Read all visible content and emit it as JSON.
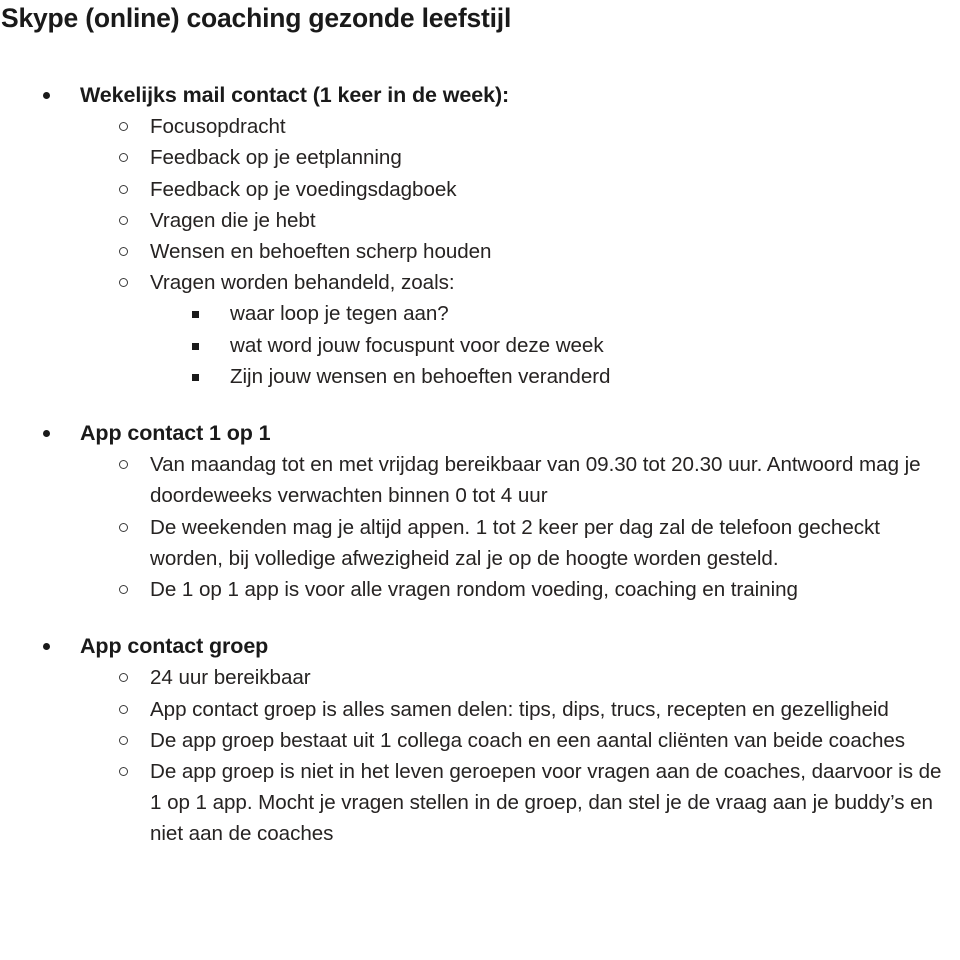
{
  "document": {
    "title": "Skype (online)  coaching gezonde leefstijl",
    "background_color": "#ffffff",
    "text_color": "#231f20",
    "sections": [
      {
        "heading": "Wekelijks mail contact (1 keer in de week):",
        "items": [
          {
            "text": "Focusopdracht"
          },
          {
            "text": "Feedback op je eetplanning"
          },
          {
            "text": "Feedback op je voedingsdagboek"
          },
          {
            "text": "Vragen die je hebt"
          },
          {
            "text": "Wensen en behoeften scherp houden"
          },
          {
            "text": "Vragen worden behandeld, zoals:",
            "subitems": [
              {
                "text": "waar loop je tegen aan?"
              },
              {
                "text": "wat word jouw focuspunt voor deze week"
              },
              {
                "text": "Zijn jouw wensen en behoeften veranderd"
              }
            ]
          }
        ]
      },
      {
        "heading": "App contact 1 op 1",
        "items": [
          {
            "text": "Van maandag tot en met vrijdag bereikbaar van 09.30 tot 20.30 uur. Antwoord mag je doordeweeks verwachten binnen 0 tot 4 uur"
          },
          {
            "text": "De weekenden mag je altijd appen. 1 tot 2 keer per dag zal de telefoon gecheckt worden, bij volledige afwezigheid zal je op de hoogte worden gesteld."
          },
          {
            "text": "De 1 op 1 app is voor alle vragen rondom voeding, coaching en training"
          }
        ]
      },
      {
        "heading": "App contact groep",
        "items": [
          {
            "text": "24 uur bereikbaar"
          },
          {
            "text": "App contact groep is alles samen delen: tips, dips, trucs, recepten en gezelligheid"
          },
          {
            "text": "De app groep bestaat uit 1 collega coach en een aantal cliënten van beide coaches"
          },
          {
            "text": "De app groep is niet in het leven geroepen voor vragen aan de coaches, daarvoor is de 1 op 1 app. Mocht je vragen stellen in de groep, dan stel je de vraag aan je buddy’s en niet aan de coaches"
          }
        ]
      }
    ]
  }
}
